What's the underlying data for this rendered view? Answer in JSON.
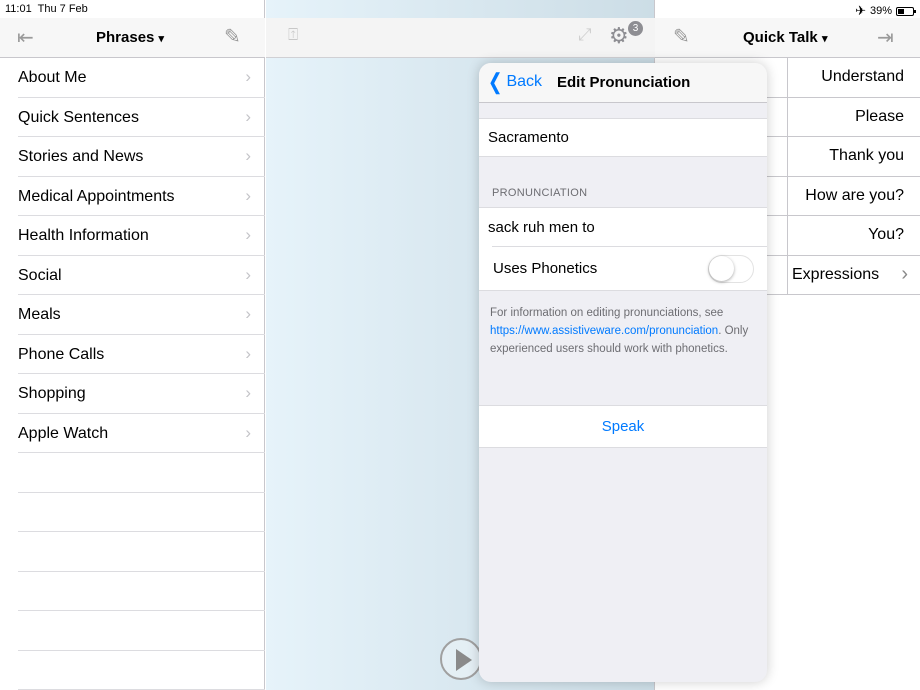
{
  "status": {
    "time": "11:01",
    "date": "Thu 7 Feb",
    "battery": "39%"
  },
  "left": {
    "title": "Phrases",
    "dropdown": "▾",
    "items": [
      {
        "label": "About Me"
      },
      {
        "label": "Quick Sentences"
      },
      {
        "label": "Stories and News"
      },
      {
        "label": "Medical Appointments"
      },
      {
        "label": "Health Information"
      },
      {
        "label": "Social"
      },
      {
        "label": "Meals"
      },
      {
        "label": "Phone Calls"
      },
      {
        "label": "Shopping"
      },
      {
        "label": "Apple Watch"
      }
    ],
    "chevron": "›"
  },
  "center": {
    "settings_badge": "3"
  },
  "right": {
    "title": "Quick Talk",
    "dropdown": "▾",
    "items": [
      {
        "label": "Understand"
      },
      {
        "label": "Please"
      },
      {
        "label": "Thank you"
      },
      {
        "label": "How are you?"
      },
      {
        "label": "You?"
      }
    ],
    "expressions_label": "Expressions",
    "chevron": "›"
  },
  "popover": {
    "back_label": "Back",
    "title": "Edit Pronunciation",
    "word": "Sacramento",
    "section_header": "PRONUNCIATION",
    "pronunciation": "sack ruh men to",
    "phonetics_label": "Uses Phonetics",
    "phonetics_on": false,
    "info_before": "For information on editing pronunciations, see",
    "info_link": "https://www.assistiveware.com/pronunciation",
    "info_after": ". Only experienced users should work with phonetics.",
    "speak_label": "Speak"
  },
  "colors": {
    "accent": "#007aff",
    "separator": "#c8c7cc",
    "badge": "#8e8e93"
  },
  "icons": [
    "airplane-icon",
    "battery-icon",
    "collapse-left-icon",
    "pencil-icon",
    "share-icon",
    "fullscreen-icon",
    "gear-icon",
    "collapse-right-icon",
    "play-icon",
    "chevron-right-icon",
    "back-chevron-icon"
  ]
}
